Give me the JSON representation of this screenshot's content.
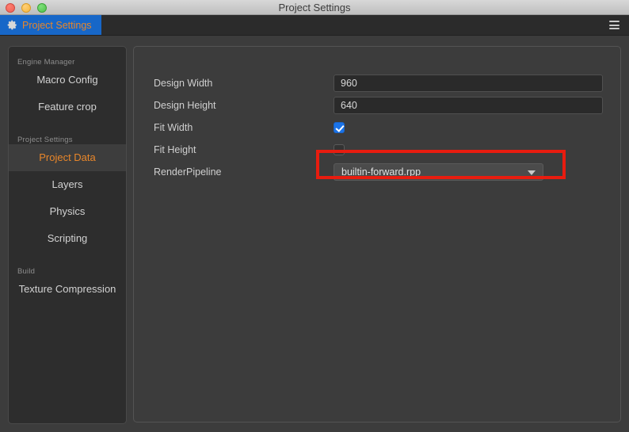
{
  "window": {
    "title": "Project Settings",
    "traffic_lights": [
      "close-button",
      "minimize-button",
      "maximize-button"
    ]
  },
  "tabbar": {
    "tab_label": "Project Settings",
    "tab_icon": "gear-icon",
    "menu_icon": "hamburger-menu-icon",
    "tab_background": "#1767c8",
    "tab_text_color": "#e8862a"
  },
  "sidebar": {
    "groups": [
      {
        "header": "Engine Manager",
        "items": [
          {
            "label": "Macro Config",
            "selected": false
          },
          {
            "label": "Feature crop",
            "selected": false
          }
        ]
      },
      {
        "header": "Project Settings",
        "items": [
          {
            "label": "Project Data",
            "selected": true
          },
          {
            "label": "Layers",
            "selected": false
          },
          {
            "label": "Physics",
            "selected": false
          },
          {
            "label": "Scripting",
            "selected": false
          }
        ]
      },
      {
        "header": "Build",
        "items": [
          {
            "label": "Texture Compression",
            "selected": false
          }
        ]
      }
    ],
    "selected_color": "#e8862a"
  },
  "main": {
    "fields": [
      {
        "label": "Design Width",
        "type": "text",
        "value": "960"
      },
      {
        "label": "Design Height",
        "type": "text",
        "value": "640"
      },
      {
        "label": "Fit Width",
        "type": "checkbox",
        "value": "checked"
      },
      {
        "label": "Fit Height",
        "type": "checkbox",
        "value": "unchecked"
      },
      {
        "label": "RenderPipeline",
        "type": "select",
        "value": "builtin-forward.rpp"
      }
    ]
  },
  "annotation": {
    "color": "#e81c0f",
    "target": "RenderPipeline"
  }
}
